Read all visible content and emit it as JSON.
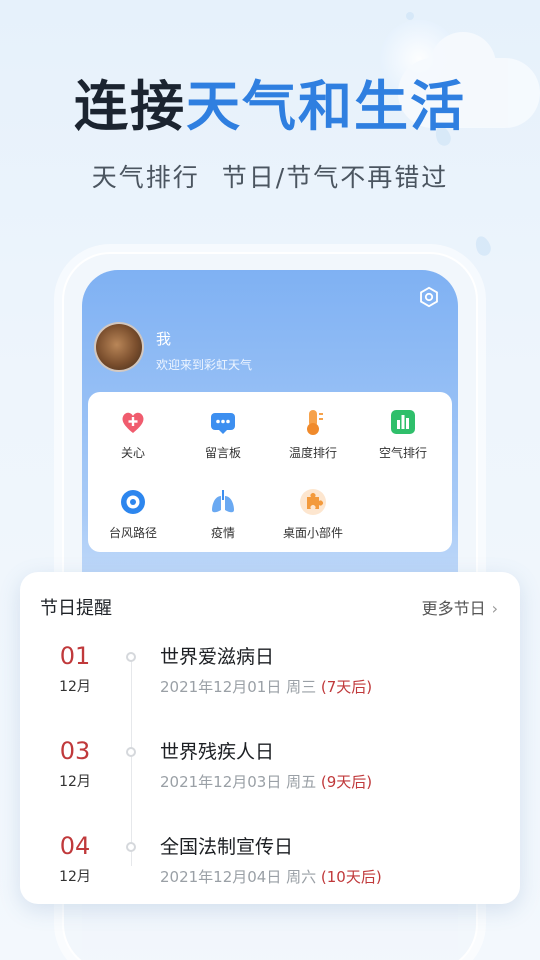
{
  "hero": {
    "title_dark": "连接",
    "title_highlight": "天气和生活",
    "subtitle_part1": "天气排行",
    "subtitle_part2": "节日/节气不再错过"
  },
  "colors": {
    "accent_blue": "#2f7fe0",
    "festival_red": "#c0393b"
  },
  "profile": {
    "name": "我",
    "welcome": "欢迎来到彩虹天气",
    "settings_icon": "gear-icon"
  },
  "menu": {
    "items": [
      {
        "label": "关心",
        "icon": "heart-plus-icon"
      },
      {
        "label": "留言板",
        "icon": "message-board-icon"
      },
      {
        "label": "温度排行",
        "icon": "thermometer-icon"
      },
      {
        "label": "空气排行",
        "icon": "bar-chart-icon"
      },
      {
        "label": "台风路径",
        "icon": "typhoon-icon"
      },
      {
        "label": "疫情",
        "icon": "lungs-icon"
      },
      {
        "label": "桌面小部件",
        "icon": "puzzle-icon"
      }
    ]
  },
  "holidays": {
    "title": "节日提醒",
    "more_label": "更多节日",
    "entries": [
      {
        "day": "01",
        "month": "12月",
        "name": "世界爱滋病日",
        "date": "2021年12月01日 周三",
        "countdown": "(7天后)"
      },
      {
        "day": "03",
        "month": "12月",
        "name": "世界残疾人日",
        "date": "2021年12月03日 周五",
        "countdown": "(9天后)"
      },
      {
        "day": "04",
        "month": "12月",
        "name": "全国法制宣传日",
        "date": "2021年12月04日 周六",
        "countdown": "(10天后)"
      }
    ]
  }
}
